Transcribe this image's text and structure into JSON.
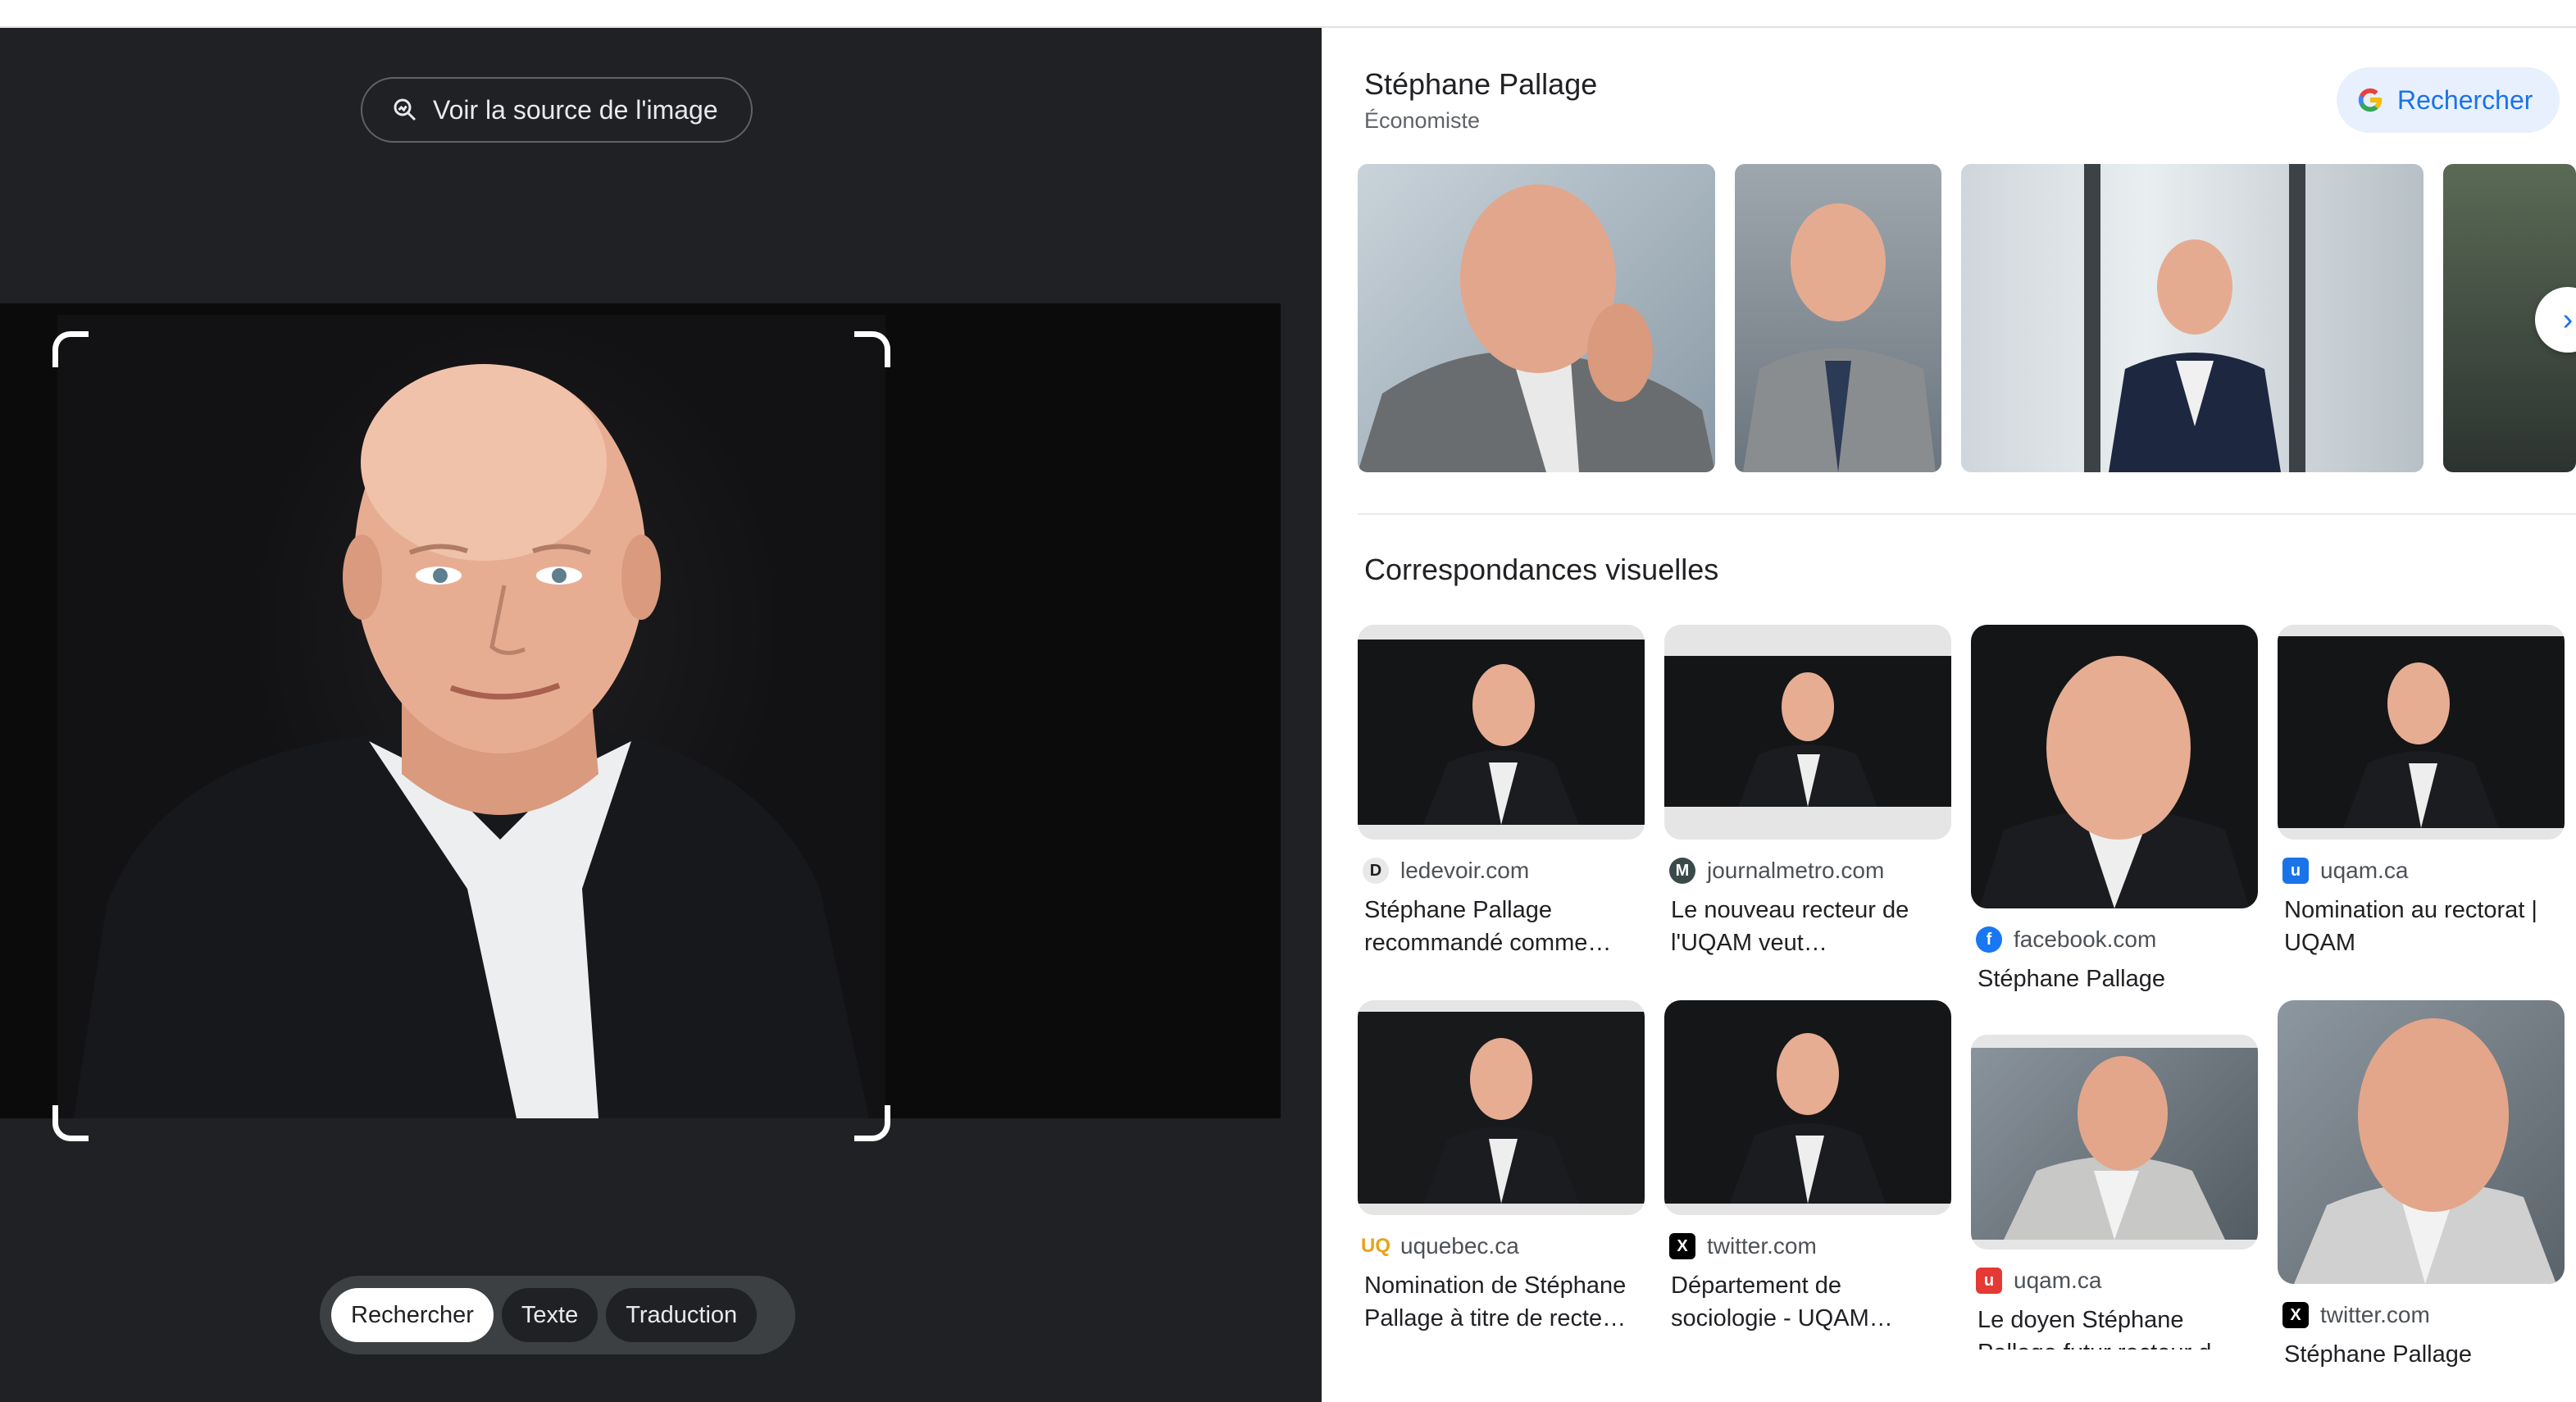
{
  "viewer": {
    "source_button_label": "Voir la source de l'image",
    "modes": [
      "Rechercher",
      "Texte",
      "Traduction"
    ],
    "active_mode": "Rechercher"
  },
  "entity": {
    "name": "Stéphane Pallage",
    "subtitle": "Économiste",
    "search_label": "Rechercher"
  },
  "visual_matches": {
    "title": "Correspondances visuelles",
    "items": [
      {
        "source": "ledevoir.com",
        "title": "Stéphane Pallage recommandé comme…",
        "favicon": "D"
      },
      {
        "source": "journalmetro.com",
        "title": "Le nouveau recteur de l'UQAM veut…",
        "favicon": "M"
      },
      {
        "source": "facebook.com",
        "title": "Stéphane Pallage",
        "favicon": "f"
      },
      {
        "source": "uqam.ca",
        "title": "Nomination au rectorat | UQAM",
        "favicon": "u"
      },
      {
        "source": "uquebec.ca",
        "title": "Nomination de Stéphane Pallage à titre de recte…",
        "favicon": "UQ"
      },
      {
        "source": "twitter.com",
        "title": "Département de sociologie - UQAM…",
        "favicon": "X"
      },
      {
        "source": "uqam.ca",
        "title": "Le doyen Stéphane Pallage futur recteur d…",
        "favicon": "u"
      },
      {
        "source": "twitter.com",
        "title": "Stéphane Pallage",
        "favicon": "X"
      }
    ]
  },
  "colors": {
    "viewer_bg": "#202124",
    "accent": "#1a73e8",
    "search_bg": "#e8f0fe"
  }
}
